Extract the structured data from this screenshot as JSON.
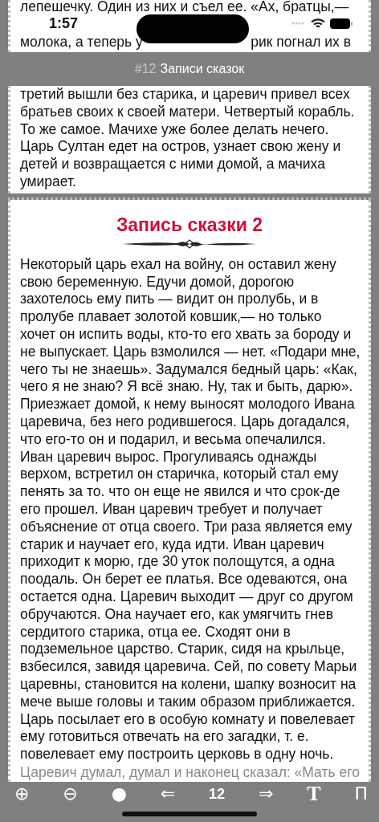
{
  "status_bar": {
    "time": "1:57"
  },
  "previous_record": {
    "top_lines": [
      "лепешечку. Один из них и съел ее. «Ах, братцы,—"
    ],
    "notch_line": {
      "left": "молока, а теперь у",
      "right": "рик погнал их в"
    },
    "lines": [
      "третий вышли без старика, и царевич привел всех",
      "братьев своих к своей матери. Четвертый корабль.",
      "То же самое. Мачихе уже более делать нечего.",
      "Царь Султан едет на остров, узнает свою жену и",
      "детей и возвращается с ними домой, а мачиха",
      "умирает."
    ]
  },
  "header": {
    "number": "#12",
    "title": "Записи сказок"
  },
  "record": {
    "title": "Запись сказки 2",
    "lines": [
      "Некоторый царь ехал на войну, он оставил жену",
      "свою беременную. Едучи домой, дорогою",
      "захотелось ему пить — видит он пролубь, и в",
      "пролубе плавает золотой ковшик,— но только",
      "хочет он испить воды, кто-то его хвать за бороду и",
      "не выпускает. Царь взмолился — нет. «Подари мне,",
      "чего ты не знаешь». Задумался бедный царь: «Как,",
      "чего я не знаю? Я всё знаю. Ну, так и быть, дарю».",
      "Приезжает домой, к нему выносят молодого Ивана",
      "царевича, без него родившегося. Царь догадался,",
      "что его-то он и подарил, и весьма опечалился.",
      "Иван царевич вырос. Прогуливаясь однажды",
      "верхом, встретил он старичка, который стал ему",
      "пенять за то. что он еще не явился и что срок-де",
      "его прошел. Иван царевич требует и получает",
      "объяснение от отца своего. Три раза является ему",
      "старик и научает его, куда идти. Иван царевич",
      "приходит к морю, где 30 уток полощутся, а одна",
      "поодаль. Он берет ее платья. Все одеваются, она",
      "остается одна. Царевич выходит — друг со другом",
      "обручаются. Она научает его, как умягчить гнев",
      "сердитого старика, отца ее. Сходят они в",
      "подземельное царство. Старик, сидя на крыльце,",
      "взбесился, завидя царевича. Сей, по совету Марьи",
      "царевны, становится на колени, шапку возносит на",
      "мече выше головы и таким образом приближается.",
      "Царь посылает его в особую комнату и повелевает",
      "ему готовиться отвечать на его загадки, т. е.",
      "повелевает ему построить церковь в одну ночь."
    ],
    "faded_line": "Царевич думал, думал и наконец сказал: «Мать его"
  },
  "toolbar": [
    {
      "kind": "zoom-in",
      "label": "⊕"
    },
    {
      "kind": "zoom-out",
      "label": "⊖"
    },
    {
      "kind": "theme",
      "label": "●"
    },
    {
      "kind": "prev",
      "label": "⇐"
    },
    {
      "kind": "page",
      "label": "12"
    },
    {
      "kind": "next",
      "label": "⇒"
    },
    {
      "kind": "font",
      "label": "T"
    },
    {
      "kind": "layout",
      "label": "П"
    }
  ]
}
